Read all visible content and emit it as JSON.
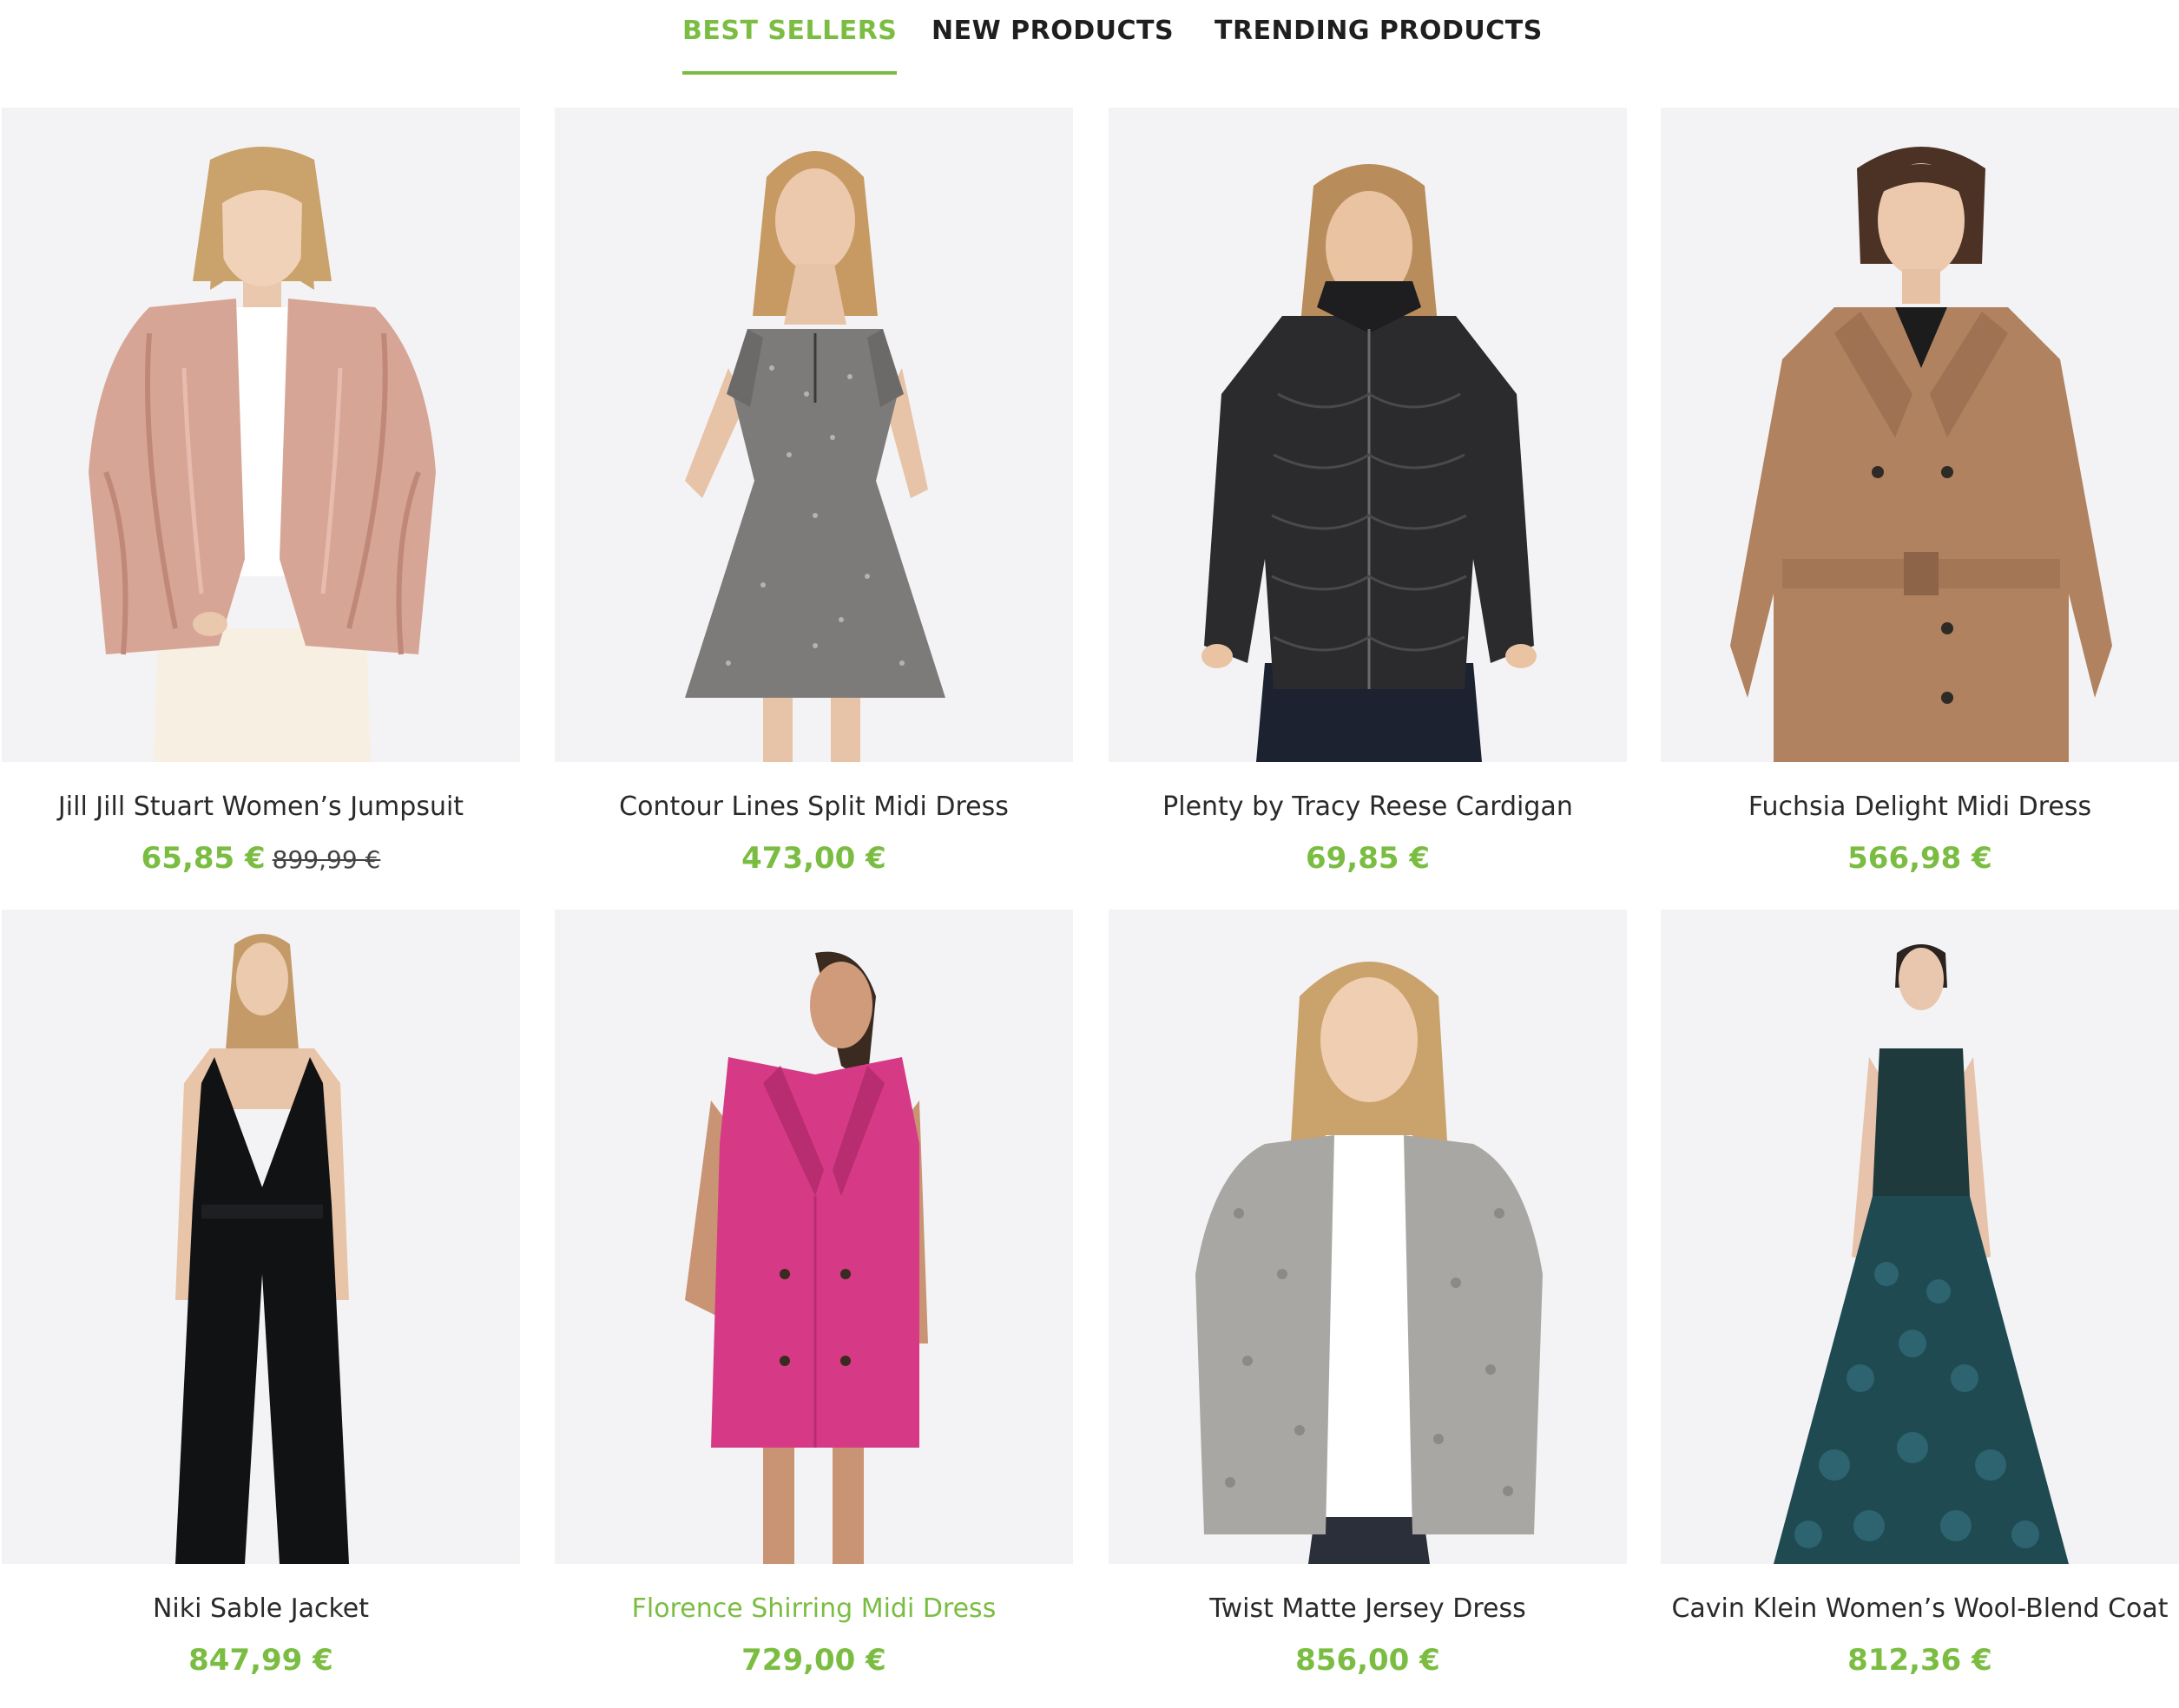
{
  "tabs": [
    {
      "label": "BEST SELLERS",
      "active": true
    },
    {
      "label": "NEW PRODUCTS",
      "active": false
    },
    {
      "label": "TRENDING PRODUCTS",
      "active": false
    }
  ],
  "colors": {
    "accent": "#7bbd42",
    "text": "#2a2a2a",
    "photo_background": "#f3f3f5"
  },
  "products": [
    {
      "name": "Jill Jill Stuart Women’s Jumpsuit",
      "price": "65,85 €",
      "old_price": "899,99 €",
      "image": "model-in-pink-faux-fur-jacket",
      "highlight": false
    },
    {
      "name": "Contour Lines Split Midi Dress",
      "price": "473,00 €",
      "old_price": "",
      "image": "model-in-grey-floral-mini-dress",
      "highlight": false
    },
    {
      "name": "Plenty by Tracy Reese Cardigan",
      "price": "69,85 €",
      "old_price": "",
      "image": "model-in-black-puffer-jacket",
      "highlight": false
    },
    {
      "name": "Fuchsia Delight Midi Dress",
      "price": "566,98 €",
      "old_price": "",
      "image": "model-in-camel-trench-coat",
      "highlight": false
    },
    {
      "name": "Niki Sable Jacket",
      "price": "847,99 €",
      "old_price": "",
      "image": "model-in-black-halter-jumpsuit",
      "highlight": false
    },
    {
      "name": "Florence Shirring Midi Dress",
      "price": "729,00 €",
      "old_price": "",
      "image": "model-in-pink-blazer-dress",
      "highlight": true
    },
    {
      "name": "Twist Matte Jersey Dress",
      "price": "856,00 €",
      "old_price": "",
      "image": "model-in-grey-boucle-cardigan",
      "highlight": false
    },
    {
      "name": "Cavin Klein Women’s Wool-Blend Coat",
      "price": "812,36 €",
      "old_price": "",
      "image": "model-in-teal-ruffled-gown",
      "highlight": false
    }
  ]
}
